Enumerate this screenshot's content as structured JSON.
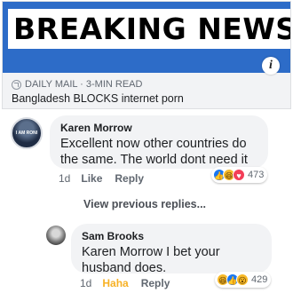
{
  "link_preview": {
    "banner_text": "BREAKING NEWS",
    "source": "DAILY MAIL · 3-MIN READ",
    "title": "Bangladesh BLOCKS internet porn",
    "info_icon": "i",
    "colors": {
      "banner_bg": "#2d6cc8",
      "card_bg": "#f2f3f5"
    }
  },
  "comments": [
    {
      "author": "Karen Morrow",
      "avatar_text": "I AM RONI",
      "text": "Excellent now other countries do the same. The world dont need it",
      "time": "1d",
      "like_label": "Like",
      "reply_label": "Reply",
      "reactions": {
        "icons": [
          "like-icon",
          "haha-icon",
          "love-icon"
        ],
        "count": "473"
      }
    },
    {
      "author": "Sam Brooks",
      "text": "Karen Morrow I bet your husband does.",
      "time": "1d",
      "like_label": "Haha",
      "reply_label": "Reply",
      "reactions": {
        "icons": [
          "haha-icon",
          "like-icon",
          "wow-icon"
        ],
        "count": "429"
      }
    }
  ],
  "view_previous_replies": "View previous replies...",
  "reaction_glyphs": {
    "like": "👍",
    "haha": "😆",
    "love": "♥",
    "wow": "😮"
  }
}
